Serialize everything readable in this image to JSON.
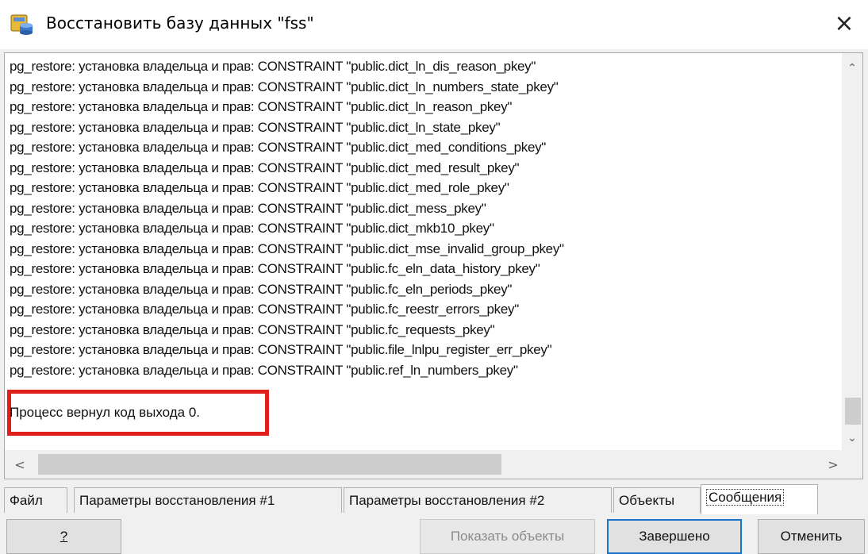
{
  "window": {
    "title": "Восстановить базу данных \"fss\"",
    "icon": "database-restore-icon",
    "close_glyph": "×"
  },
  "log": {
    "lines": [
      "pg_restore: установка владельца и прав: CONSTRAINT \"public.dict_ln_dis_reason_pkey\"",
      "pg_restore: установка владельца и прав: CONSTRAINT \"public.dict_ln_numbers_state_pkey\"",
      "pg_restore: установка владельца и прав: CONSTRAINT \"public.dict_ln_reason_pkey\"",
      "pg_restore: установка владельца и прав: CONSTRAINT \"public.dict_ln_state_pkey\"",
      "pg_restore: установка владельца и прав: CONSTRAINT \"public.dict_med_conditions_pkey\"",
      "pg_restore: установка владельца и прав: CONSTRAINT \"public.dict_med_result_pkey\"",
      "pg_restore: установка владельца и прав: CONSTRAINT \"public.dict_med_role_pkey\"",
      "pg_restore: установка владельца и прав: CONSTRAINT \"public.dict_mess_pkey\"",
      "pg_restore: установка владельца и прав: CONSTRAINT \"public.dict_mkb10_pkey\"",
      "pg_restore: установка владельца и прав: CONSTRAINT \"public.dict_mse_invalid_group_pkey\"",
      "pg_restore: установка владельца и прав: CONSTRAINT \"public.fc_eln_data_history_pkey\"",
      "pg_restore: установка владельца и прав: CONSTRAINT \"public.fc_eln_periods_pkey\"",
      "pg_restore: установка владельца и прав: CONSTRAINT \"public.fc_reestr_errors_pkey\"",
      "pg_restore: установка владельца и прав: CONSTRAINT \"public.fc_requests_pkey\"",
      "pg_restore: установка владельца и прав: CONSTRAINT \"public.file_lnlpu_register_err_pkey\"",
      "pg_restore: установка владельца и прав: CONSTRAINT \"public.ref_ln_numbers_pkey\""
    ],
    "exit_message": "Процесс вернул код выхода 0.",
    "highlight_color": "#e0201a"
  },
  "scrollbars": {
    "up_glyph": "⌃",
    "down_glyph": "⌄",
    "left_glyph": "<",
    "right_glyph": ">"
  },
  "tabs": [
    {
      "label": "Файл",
      "active": false
    },
    {
      "label": "Параметры восстановления #1",
      "active": false
    },
    {
      "label": "Параметры восстановления #2",
      "active": false
    },
    {
      "label": "Объекты",
      "active": false
    },
    {
      "label": "Сообщения",
      "active": true
    }
  ],
  "buttons": {
    "help": "?",
    "show_objects": "Показать объекты",
    "done": "Завершено",
    "cancel": "Отменить"
  }
}
